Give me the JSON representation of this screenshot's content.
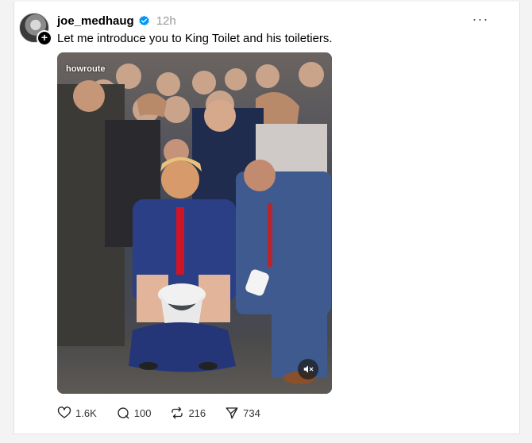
{
  "post": {
    "username": "joe_medhaug",
    "timestamp": "12h",
    "text": "Let me introduce you to King Toilet and his toiletiers.",
    "watermark": "howroute",
    "follow_badge": "+",
    "more_glyph": "···"
  },
  "actions": {
    "likes": "1.6K",
    "replies": "100",
    "reposts": "216",
    "shares": "734"
  },
  "icons": {
    "verified": "verified-badge-icon",
    "like": "heart-icon",
    "reply": "comment-bubble-icon",
    "repost": "repost-icon",
    "share": "send-icon",
    "mute": "speaker-muted-icon"
  },
  "colors": {
    "verified": "#0095f6",
    "timestamp": "#999999",
    "background": "#f3f3f3"
  }
}
